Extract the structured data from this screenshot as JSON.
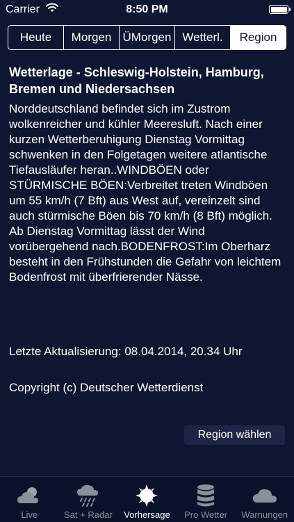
{
  "status_bar": {
    "carrier": "Carrier",
    "time": "8:50 PM"
  },
  "segments": [
    {
      "label": "Heute"
    },
    {
      "label": "Morgen"
    },
    {
      "label": "ÜMorgen"
    },
    {
      "label": "Wetterl."
    },
    {
      "label": "Region"
    }
  ],
  "selected_segment": "Region",
  "report": {
    "title": "Wetterlage - Schleswig-Holstein, Hamburg, Bremen und Niedersachsen",
    "body": "Norddeutschland befindet sich im Zustrom wolkenreicher und kühler Meeresluft. Nach einer kurzen Wetterberuhigung Dienstag Vormittag schwenken in den Folgetagen weitere atlantische Tiefausläufer heran..WINDBÖEN oder STÜRMISCHE BÖEN:Verbreitet treten Windböen um 55 km/h (7 Bft) aus West auf, vereinzelt sind auch stürmische Böen bis 70 km/h (8 Bft) möglich. Ab Dienstag Vormittag lässt der Wind vorübergehend nach.BODENFROST:Im Oberharz besteht in den Frühstunden die Gefahr von leichtem Bodenfrost mit überfrierender Nässe.",
    "last_update": "Letzte Aktualisierung: 08.04.2014, 20.34 Uhr",
    "copyright": "Copyright (c) Deutscher Wetterdienst"
  },
  "region_button_label": "Region wählen",
  "tabs": [
    {
      "label": "Live",
      "icon": "cloud-sun-icon"
    },
    {
      "label": "Sat + Radar",
      "icon": "cloud-rain-icon"
    },
    {
      "label": "Vorhersage",
      "icon": "sun-icon"
    },
    {
      "label": "Pro Wetter",
      "icon": "database-icon"
    },
    {
      "label": "Warnungen",
      "icon": "cloud-icon"
    }
  ],
  "selected_tab": "Vorhersage",
  "colors": {
    "background": "#0f1632",
    "tab_bar": "#0b1128",
    "button": "#1d2745",
    "inactive_tab": "#8a8f9c"
  }
}
